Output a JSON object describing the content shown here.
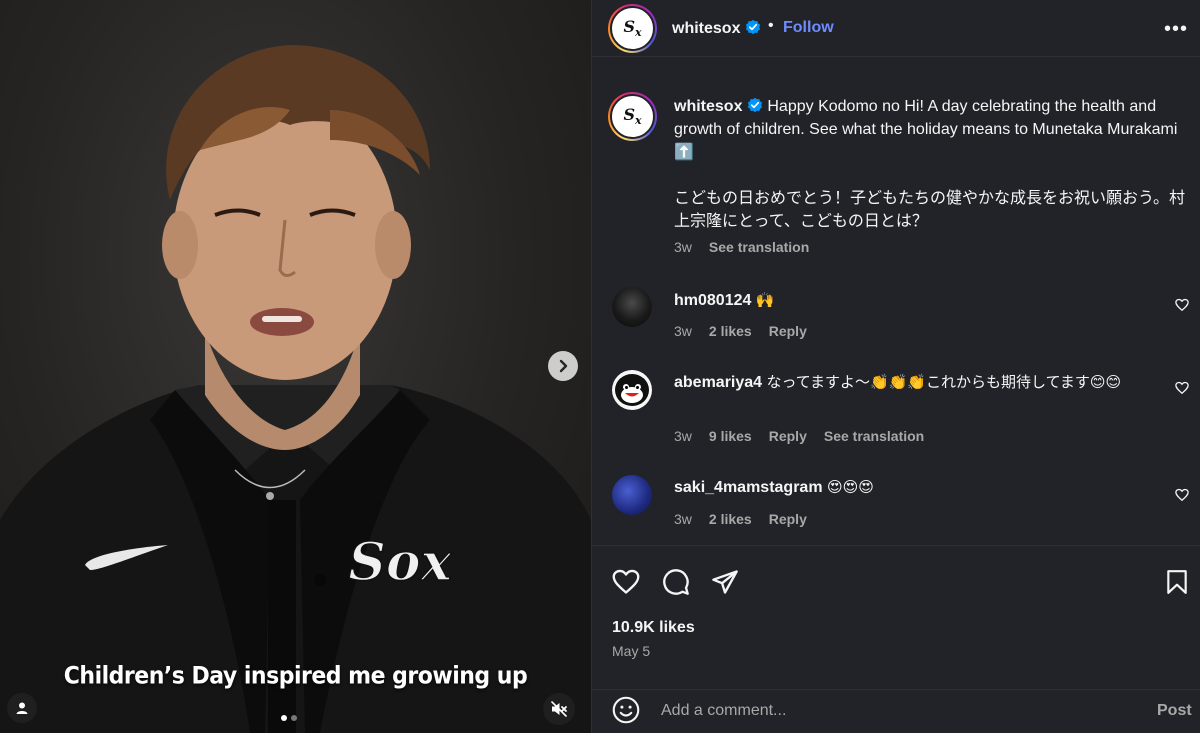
{
  "media": {
    "caption": "Children’s Day inspired me growing up",
    "slide_count": 2,
    "active_slide": 1,
    "jersey_logo": "Sox",
    "brand_mark": "swoosh"
  },
  "header": {
    "username": "whitesox",
    "separator": "•",
    "follow_label": "Follow",
    "more_label": "•••"
  },
  "post": {
    "username": "whitesox",
    "caption_en": "Happy Kodomo no Hi! A day celebrating the health and growth of children. See what the holiday means to Munetaka Murakami ⬆️",
    "caption_ja": "こどもの日おめでとう！子どもたちの健やかな成長をお祝い願おう。村上宗隆にとって、こどもの日とは？",
    "time": "3w",
    "see_translation": "See translation"
  },
  "comments": [
    {
      "username": "hm080124",
      "text": "🙌",
      "time": "3w",
      "likes": "2 likes",
      "reply": "Reply"
    },
    {
      "username": "abemariya4",
      "text": "なってますよ〜👏👏👏これからも期待してます😊😊",
      "time": "3w",
      "likes": "9 likes",
      "reply": "Reply",
      "see_translation": "See translation"
    },
    {
      "username": "saki_4mamstagram",
      "text": "😍😍😍",
      "time": "3w",
      "likes": "2 likes",
      "reply": "Reply"
    }
  ],
  "actions": {
    "likes": "10.9K likes",
    "date": "May 5"
  },
  "comment_bar": {
    "placeholder": "Add a comment...",
    "post_label": "Post"
  },
  "colors": {
    "panel_bg": "#212328",
    "accent_link": "#6e8bff",
    "verified": "#0095f6",
    "secondary_text": "#a8a8a8"
  },
  "icons": [
    "chevron-right-icon",
    "user-icon",
    "mute-icon",
    "heart-icon",
    "comment-icon",
    "share-icon",
    "bookmark-icon",
    "emoji-icon",
    "verified-icon",
    "more-icon"
  ]
}
